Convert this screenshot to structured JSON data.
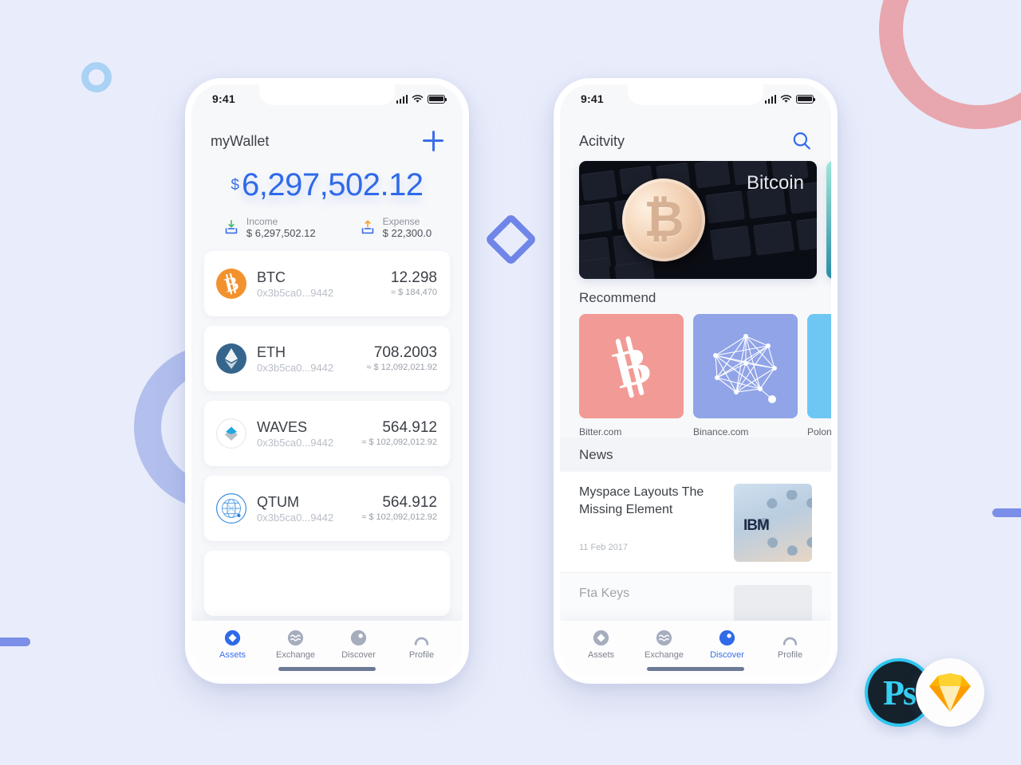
{
  "wallet_screen": {
    "status_bar": {
      "time": "9:41",
      "signal_icon": "signal-bars-icon",
      "wifi_icon": "wifi-icon",
      "battery_icon": "battery-icon"
    },
    "title": "myWallet",
    "add_button_icon": "plus-icon",
    "balance": {
      "currency_symbol": "$",
      "amount": "6,297,502.12"
    },
    "income": {
      "icon": "income-download-icon",
      "label": "Income",
      "value": "$ 6,297,502.12"
    },
    "expense": {
      "icon": "expense-upload-icon",
      "label": "Expense",
      "value": "$ 22,300.0"
    },
    "assets": [
      {
        "icon": "btc-coin-icon",
        "symbol": "BTC",
        "address": "0x3b5ca0...9442",
        "amount": "12.298",
        "fiat": "≈ $ 184,470"
      },
      {
        "icon": "eth-coin-icon",
        "symbol": "ETH",
        "address": "0x3b5ca0...9442",
        "amount": "708.2003",
        "fiat": "≈ $ 12,092,021.92"
      },
      {
        "icon": "waves-coin-icon",
        "symbol": "WAVES",
        "address": "0x3b5ca0...9442",
        "amount": "564.912",
        "fiat": "≈ $ 102,092,012.92"
      },
      {
        "icon": "qtum-coin-icon",
        "symbol": "QTUM",
        "address": "0x3b5ca0...9442",
        "amount": "564.912",
        "fiat": "≈ $ 102,092,012.92"
      }
    ],
    "tabs": [
      {
        "icon": "assets-diamond-icon",
        "label": "Assets",
        "active": true
      },
      {
        "icon": "exchange-waves-icon",
        "label": "Exchange",
        "active": false
      },
      {
        "icon": "discover-compass-icon",
        "label": "Discover",
        "active": false
      },
      {
        "icon": "profile-person-icon",
        "label": "Profile",
        "active": false
      }
    ]
  },
  "discover_screen": {
    "status_bar": {
      "time": "9:41",
      "signal_icon": "signal-bars-icon",
      "wifi_icon": "wifi-icon",
      "battery_icon": "battery-icon"
    },
    "title": "Acitvity",
    "search_button_icon": "search-icon",
    "banner": {
      "title": "Bitcoin",
      "image": "bitcoin-coin-on-keyboard-photo"
    },
    "recommend_section_title": "Recommend",
    "recommend": [
      {
        "label": "Bitter.com",
        "icon": "bitcoin-b-icon",
        "color": "#f29a95"
      },
      {
        "label": "Binance.com",
        "icon": "network-mesh-icon",
        "color": "#91a4e8"
      },
      {
        "label": "Polonie",
        "icon": "blank-icon",
        "color": "#6ec7f2"
      }
    ],
    "news_section_title": "News",
    "news": [
      {
        "title": "Myspace Layouts The Missing Element",
        "date": "11 Feb 2017",
        "thumb": "ibm-dotted-ring-photo"
      },
      {
        "title": "Fta Keys",
        "date": "",
        "thumb": "person-portrait-photo"
      }
    ],
    "tabs": [
      {
        "icon": "assets-diamond-icon",
        "label": "Assets",
        "active": false
      },
      {
        "icon": "exchange-waves-icon",
        "label": "Exchange",
        "active": false
      },
      {
        "icon": "discover-compass-icon",
        "label": "Discover",
        "active": true
      },
      {
        "icon": "profile-person-icon",
        "label": "Profile",
        "active": false
      }
    ]
  },
  "decorations": {
    "ring_pink": "pink-ring-decoration",
    "ring_periwinkle": "periwinkle-ring-decoration",
    "ring_blue_small": "blue-circle-decoration",
    "diamond": "blue-diamond-decoration",
    "bar_left": "blue-bar-decoration-left",
    "bar_right": "blue-bar-decoration-right"
  },
  "badges": [
    {
      "name": "photoshop-badge",
      "label": "Ps"
    },
    {
      "name": "sketch-badge",
      "label": ""
    }
  ],
  "colors": {
    "accent_blue": "#3b6fe8",
    "background": "#e9edfb",
    "pink": "#e8a6ae",
    "periwinkle": "#b3c0ee"
  }
}
